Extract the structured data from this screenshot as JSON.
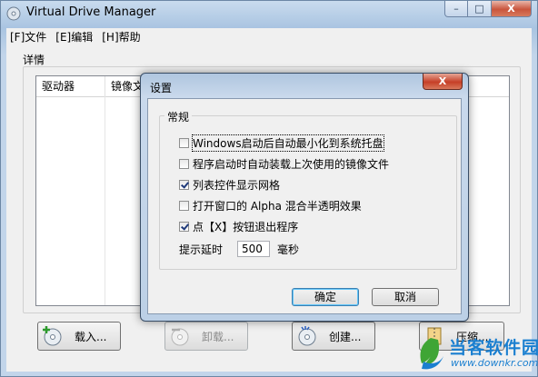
{
  "window": {
    "title": "Virtual Drive Manager",
    "controls": {
      "minimize": "–",
      "maximize": "□",
      "close": "X"
    }
  },
  "menu": [
    {
      "label": "[F]文件"
    },
    {
      "label": "[E]编辑"
    },
    {
      "label": "[H]帮助"
    }
  ],
  "details": {
    "group_label": "详情",
    "columns": [
      "驱动器",
      "镜像文"
    ]
  },
  "bottom_buttons": [
    {
      "label": "载入...",
      "icon": "cd-add-icon",
      "enabled": true
    },
    {
      "label": "卸载...",
      "icon": "cd-eject-icon",
      "enabled": false
    },
    {
      "label": "创建...",
      "icon": "cd-create-icon",
      "enabled": true
    },
    {
      "label": "压缩...",
      "icon": "compress-icon",
      "enabled": true
    }
  ],
  "dialog": {
    "title": "设置",
    "close": "X",
    "group_label": "常规",
    "options": [
      {
        "label": "Windows启动后自动最小化到系统托盘",
        "checked": false
      },
      {
        "label": "程序启动时自动装载上次使用的镜像文件",
        "checked": false
      },
      {
        "label": "列表控件显示网格",
        "checked": true
      },
      {
        "label": "打开窗口的 Alpha 混合半透明效果",
        "checked": false
      },
      {
        "label": "点【X】按钮退出程序",
        "checked": true
      }
    ],
    "delay": {
      "label": "提示延时",
      "value": "500",
      "unit": "毫秒"
    },
    "ok": "确定",
    "cancel": "取消"
  },
  "watermark": {
    "title": "当客软件园",
    "url": "www.downkr.com"
  },
  "colors": {
    "accent": "#1a7fd0",
    "close_red": "#c63f27"
  }
}
